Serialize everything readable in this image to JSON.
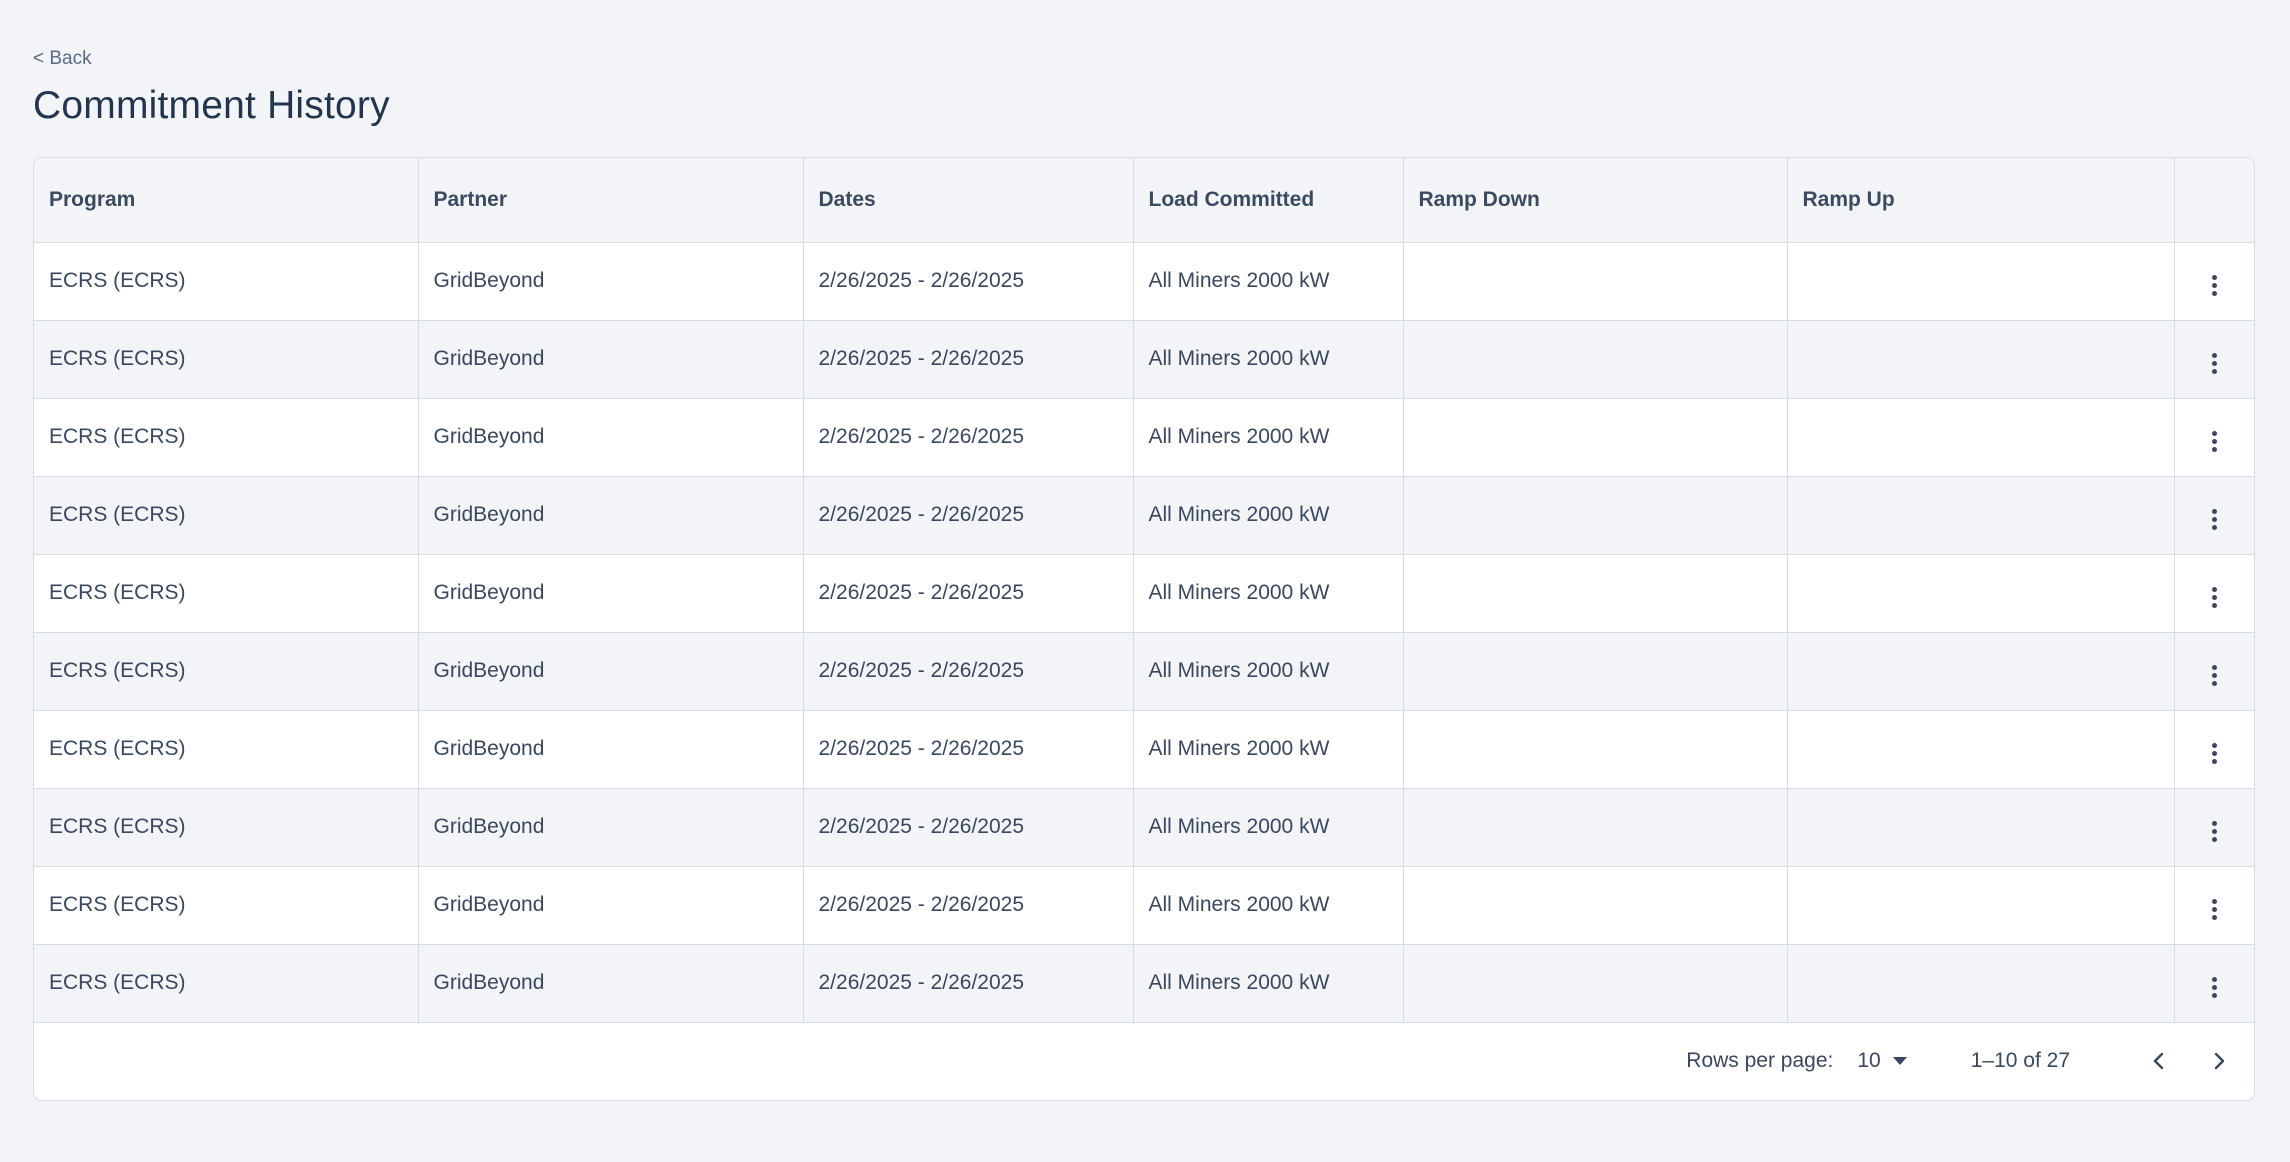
{
  "nav": {
    "back_label": "< Back"
  },
  "page": {
    "title": "Commitment History"
  },
  "table": {
    "columns": [
      "Program",
      "Partner",
      "Dates",
      "Load Committed",
      "Ramp Down",
      "Ramp Up",
      ""
    ],
    "rows": [
      {
        "program": "ECRS (ECRS)",
        "partner": "GridBeyond",
        "dates": "2/26/2025 - 2/26/2025",
        "load": "All Miners 2000 kW",
        "ramp_down": "",
        "ramp_up": ""
      },
      {
        "program": "ECRS (ECRS)",
        "partner": "GridBeyond",
        "dates": "2/26/2025 - 2/26/2025",
        "load": "All Miners 2000 kW",
        "ramp_down": "",
        "ramp_up": ""
      },
      {
        "program": "ECRS (ECRS)",
        "partner": "GridBeyond",
        "dates": "2/26/2025 - 2/26/2025",
        "load": "All Miners 2000 kW",
        "ramp_down": "",
        "ramp_up": ""
      },
      {
        "program": "ECRS (ECRS)",
        "partner": "GridBeyond",
        "dates": "2/26/2025 - 2/26/2025",
        "load": "All Miners 2000 kW",
        "ramp_down": "",
        "ramp_up": ""
      },
      {
        "program": "ECRS (ECRS)",
        "partner": "GridBeyond",
        "dates": "2/26/2025 - 2/26/2025",
        "load": "All Miners 2000 kW",
        "ramp_down": "",
        "ramp_up": ""
      },
      {
        "program": "ECRS (ECRS)",
        "partner": "GridBeyond",
        "dates": "2/26/2025 - 2/26/2025",
        "load": "All Miners 2000 kW",
        "ramp_down": "",
        "ramp_up": ""
      },
      {
        "program": "ECRS (ECRS)",
        "partner": "GridBeyond",
        "dates": "2/26/2025 - 2/26/2025",
        "load": "All Miners 2000 kW",
        "ramp_down": "",
        "ramp_up": ""
      },
      {
        "program": "ECRS (ECRS)",
        "partner": "GridBeyond",
        "dates": "2/26/2025 - 2/26/2025",
        "load": "All Miners 2000 kW",
        "ramp_down": "",
        "ramp_up": ""
      },
      {
        "program": "ECRS (ECRS)",
        "partner": "GridBeyond",
        "dates": "2/26/2025 - 2/26/2025",
        "load": "All Miners 2000 kW",
        "ramp_down": "",
        "ramp_up": ""
      },
      {
        "program": "ECRS (ECRS)",
        "partner": "GridBeyond",
        "dates": "2/26/2025 - 2/26/2025",
        "load": "All Miners 2000 kW",
        "ramp_down": "",
        "ramp_up": ""
      }
    ],
    "row_action_icon": "more-vertical-icon"
  },
  "pagination": {
    "rows_per_page_label": "Rows per page:",
    "rows_per_page_value": "10",
    "range_text": "1–10 of 27",
    "prev_icon": "chevron-left-icon",
    "next_icon": "chevron-right-icon"
  },
  "colors": {
    "background": "#f2f4f8",
    "text": "#2d3b52",
    "border": "#d7dde6",
    "row_alt": "#f2f4f8"
  }
}
